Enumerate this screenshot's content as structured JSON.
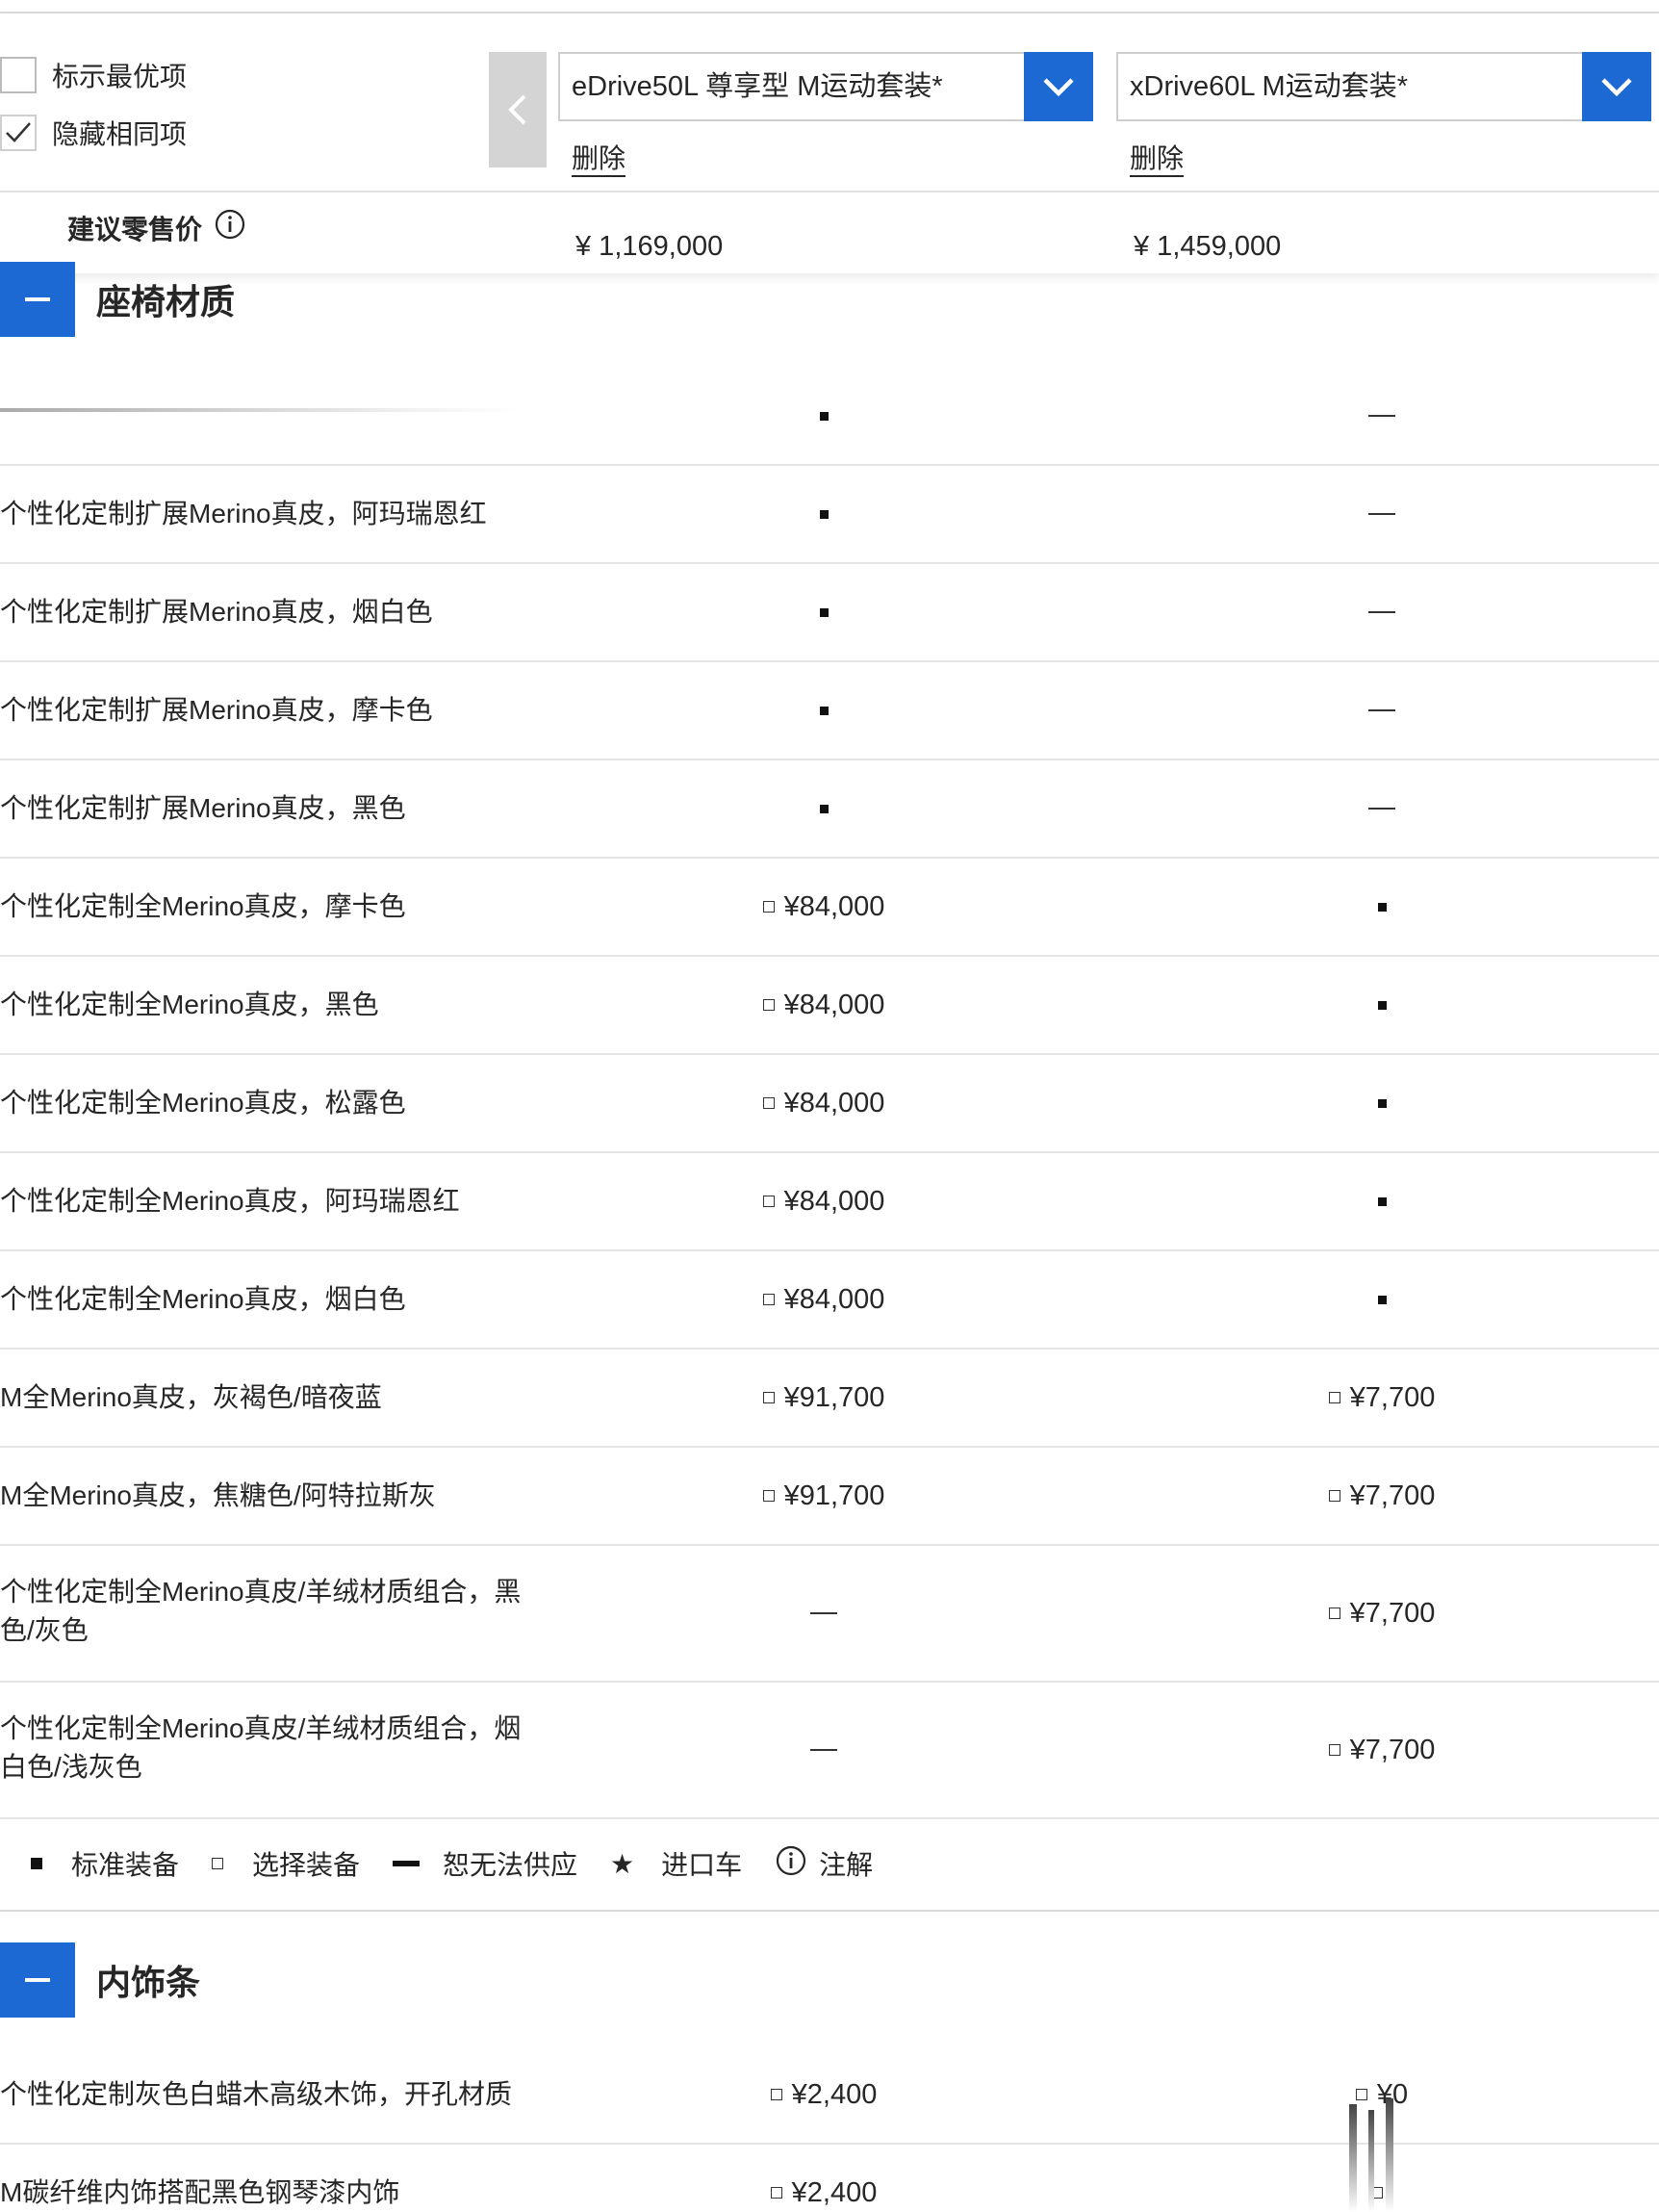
{
  "filters": {
    "mark_best": {
      "label": "标示最优项",
      "checked": false
    },
    "hide_same": {
      "label": "隐藏相同项",
      "checked": true
    }
  },
  "models": [
    {
      "name": "eDrive50L 尊享型 M运动套装*",
      "delete_label": "删除",
      "price": "¥ 1,169,000"
    },
    {
      "name": "xDrive60L M运动套装*",
      "delete_label": "删除",
      "price": "¥ 1,459,000"
    }
  ],
  "price_label": "建议零售价",
  "sections": [
    {
      "title": "座椅材质",
      "rows": [
        {
          "name": "",
          "c1": {
            "type": "std",
            "text": ""
          },
          "c2": {
            "type": "dash",
            "text": ""
          }
        },
        {
          "name": "个性化定制扩展Merino真皮，阿玛瑞恩红",
          "c1": {
            "type": "std",
            "text": ""
          },
          "c2": {
            "type": "dash",
            "text": ""
          }
        },
        {
          "name": "个性化定制扩展Merino真皮，烟白色",
          "c1": {
            "type": "std",
            "text": ""
          },
          "c2": {
            "type": "dash",
            "text": ""
          }
        },
        {
          "name": "个性化定制扩展Merino真皮，摩卡色",
          "c1": {
            "type": "std",
            "text": ""
          },
          "c2": {
            "type": "dash",
            "text": ""
          }
        },
        {
          "name": "个性化定制扩展Merino真皮，黑色",
          "c1": {
            "type": "std",
            "text": ""
          },
          "c2": {
            "type": "dash",
            "text": ""
          }
        },
        {
          "name": "个性化定制全Merino真皮，摩卡色",
          "c1": {
            "type": "opt",
            "text": "¥84,000"
          },
          "c2": {
            "type": "std",
            "text": ""
          }
        },
        {
          "name": "个性化定制全Merino真皮，黑色",
          "c1": {
            "type": "opt",
            "text": "¥84,000"
          },
          "c2": {
            "type": "std",
            "text": ""
          }
        },
        {
          "name": "个性化定制全Merino真皮，松露色",
          "c1": {
            "type": "opt",
            "text": "¥84,000"
          },
          "c2": {
            "type": "std",
            "text": ""
          }
        },
        {
          "name": "个性化定制全Merino真皮，阿玛瑞恩红",
          "c1": {
            "type": "opt",
            "text": "¥84,000"
          },
          "c2": {
            "type": "std",
            "text": ""
          }
        },
        {
          "name": "个性化定制全Merino真皮，烟白色",
          "c1": {
            "type": "opt",
            "text": "¥84,000"
          },
          "c2": {
            "type": "std",
            "text": ""
          }
        },
        {
          "name": "M全Merino真皮，灰褐色/暗夜蓝",
          "c1": {
            "type": "opt",
            "text": "¥91,700"
          },
          "c2": {
            "type": "opt",
            "text": "¥7,700"
          }
        },
        {
          "name": "M全Merino真皮，焦糖色/阿特拉斯灰",
          "c1": {
            "type": "opt",
            "text": "¥91,700"
          },
          "c2": {
            "type": "opt",
            "text": "¥7,700"
          }
        },
        {
          "name": "个性化定制全Merino真皮/羊绒材质组合，黑色/灰色",
          "c1": {
            "type": "dash",
            "text": ""
          },
          "c2": {
            "type": "opt",
            "text": "¥7,700"
          }
        },
        {
          "name": "个性化定制全Merino真皮/羊绒材质组合，烟白色/浅灰色",
          "c1": {
            "type": "dash",
            "text": ""
          },
          "c2": {
            "type": "opt",
            "text": "¥7,700"
          }
        }
      ]
    },
    {
      "title": "内饰条",
      "rows": [
        {
          "name": "个性化定制灰色白蜡木高级木饰，开孔材质",
          "c1": {
            "type": "opt",
            "text": "¥2,400"
          },
          "c2": {
            "type": "opt",
            "text": "¥0"
          }
        },
        {
          "name": "M碳纤维内饰搭配黑色钢琴漆内饰",
          "c1": {
            "type": "opt",
            "text": "¥2,400"
          },
          "c2": {
            "type": "opt",
            "text": ""
          }
        }
      ]
    }
  ],
  "legend": {
    "standard": "标准装备",
    "optional": "选择装备",
    "unavailable": "恕无法供应",
    "imported": "进口车",
    "note": "注解"
  },
  "colors": {
    "accent": "#1c69d4",
    "text": "#262626",
    "divider": "#e6e6e6"
  }
}
